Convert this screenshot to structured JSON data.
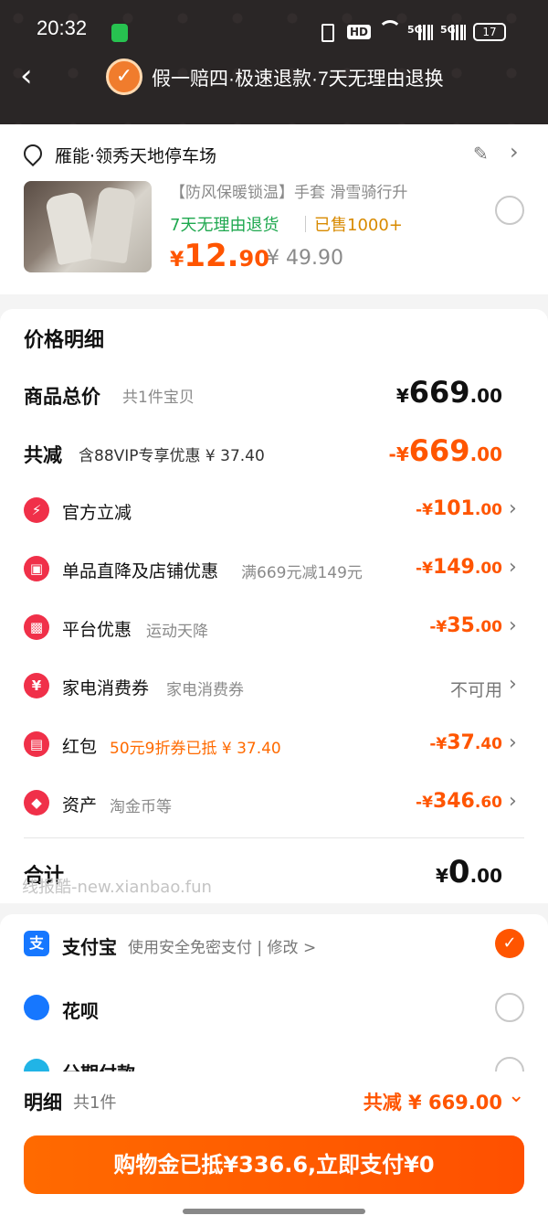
{
  "status_bar": {
    "time": "20:32",
    "network_a": "HD",
    "signal_5g_a": "5G",
    "signal_5g_b": "5G",
    "battery": "17"
  },
  "header": {
    "title": "假一赔四·极速退款·7天无理由退换"
  },
  "address": {
    "text": "雁能·领秀天地停车场"
  },
  "product": {
    "title": "【防风保暖锁温】手套 滑雪骑行升",
    "tag_return": "7天无理由退货",
    "tag_sold": "已售1000+",
    "currency": "¥",
    "price_int": "12.",
    "price_dec": "90",
    "orig_price": "¥ 49.90"
  },
  "price_detail": {
    "heading": "价格明细",
    "total_label": "商品总价",
    "total_sub": "共1件宝贝",
    "total_val_prefix": "¥",
    "total_val_int": "669",
    "total_val_dec": ".00",
    "reduce_label": "共减",
    "reduce_sub": "含88VIP专享优惠 ¥ 37.40",
    "reduce_val_prefix": "-¥",
    "reduce_val_int": "669",
    "reduce_val_dec": ".00",
    "items": [
      {
        "label": "官方立减",
        "sub": "",
        "val_prefix": "-¥",
        "val_int": "101",
        "val_dec": ".00"
      },
      {
        "label": "单品直降及店铺优惠",
        "sub": "满669元减149元",
        "val_prefix": "-¥",
        "val_int": "149",
        "val_dec": ".00"
      },
      {
        "label": "平台优惠",
        "sub": "运动天降",
        "val_prefix": "-¥",
        "val_int": "35",
        "val_dec": ".00"
      },
      {
        "label": "家电消费券",
        "sub": "家电消费券",
        "val_text": "不可用"
      },
      {
        "label": "红包",
        "sub": "50元9折券已抵 ¥ 37.40",
        "val_prefix": "-¥",
        "val_int": "37",
        "val_dec": ".40"
      },
      {
        "label": "资产",
        "sub": "淘金币等",
        "val_prefix": "-¥",
        "val_int": "346",
        "val_dec": ".60"
      }
    ],
    "sum_label": "合计",
    "sum_prefix": "¥",
    "sum_int": "0",
    "sum_dec": ".00",
    "watermark": "线报酷-new.xianbao.fun"
  },
  "payment": {
    "alipay_label": "支付宝",
    "alipay_sub": "使用安全免密支付 | 修改 >",
    "huabei_label": "花呗",
    "installment_label": "分期付款"
  },
  "footer": {
    "detail_label": "明细",
    "detail_count": "共1件",
    "reduce_total": "共减 ¥ 669.00",
    "pay_button": "购物金已抵¥336.6,立即支付¥0"
  },
  "colors": {
    "accent": "#ff5500",
    "icon_red": "#f03049",
    "green": "#1fa84f",
    "alipay_blue": "#1677ff"
  }
}
